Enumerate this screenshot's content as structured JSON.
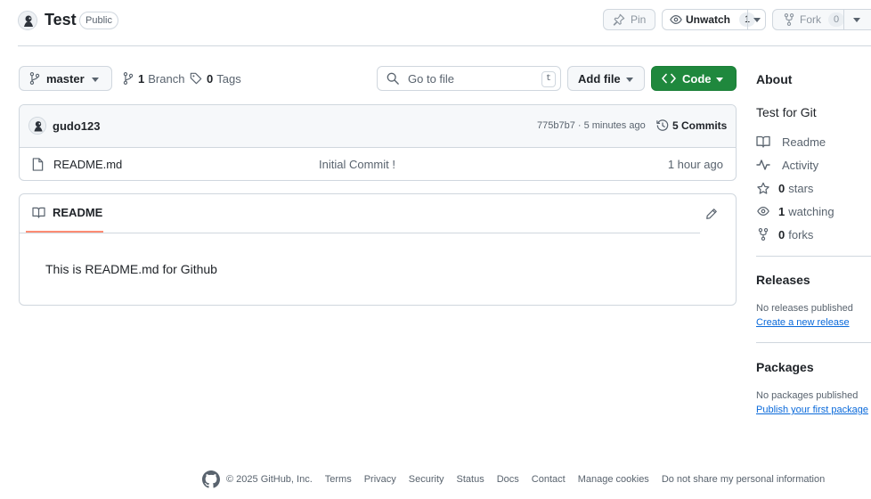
{
  "repo": {
    "name": "Test",
    "visibility": "Public"
  },
  "header": {
    "pin_label": "Pin",
    "unwatch_label": "Unwatch",
    "watch_count": "1",
    "fork_label": "Fork",
    "fork_count": "0"
  },
  "toolbar": {
    "branch": "master",
    "branches_count": "1",
    "branches_label": "Branch",
    "tags_count": "0",
    "tags_label": "Tags",
    "search_placeholder": "Go to file",
    "search_shortcut": "t",
    "add_file_label": "Add file",
    "code_label": "Code"
  },
  "latest_commit": {
    "author": "gudo123",
    "meta": "775b7b7 · 5 minutes ago",
    "commits_label": "5 Commits"
  },
  "files": [
    {
      "name": "README.md",
      "message": "Initial Commit !",
      "time": "1 hour ago"
    }
  ],
  "readme": {
    "tab_label": "README",
    "body": "This is README.md for Github"
  },
  "sidebar": {
    "about_title": "About",
    "description": "Test for Git",
    "items": [
      {
        "icon": "book-icon",
        "count": "",
        "label": "Readme"
      },
      {
        "icon": "pulse-icon",
        "count": "",
        "label": "Activity"
      },
      {
        "icon": "star-icon",
        "count": "0",
        "label": "stars"
      },
      {
        "icon": "eye-icon",
        "count": "1",
        "label": "watching"
      },
      {
        "icon": "fork-icon",
        "count": "0",
        "label": "forks"
      }
    ],
    "releases_title": "Releases",
    "releases_none": "No releases published",
    "releases_link": "Create a new release",
    "packages_title": "Packages",
    "packages_none": "No packages published",
    "packages_link": "Publish your first package"
  },
  "footer": {
    "copyright": "© 2025 GitHub, Inc.",
    "links": [
      "Terms",
      "Privacy",
      "Security",
      "Status",
      "Docs",
      "Contact",
      "Manage cookies",
      "Do not share my personal information"
    ]
  },
  "colors": {
    "primary_button": "#1f883d",
    "link": "#0969da",
    "tab_underline": "#fd8c73",
    "border": "#d0d7de"
  }
}
